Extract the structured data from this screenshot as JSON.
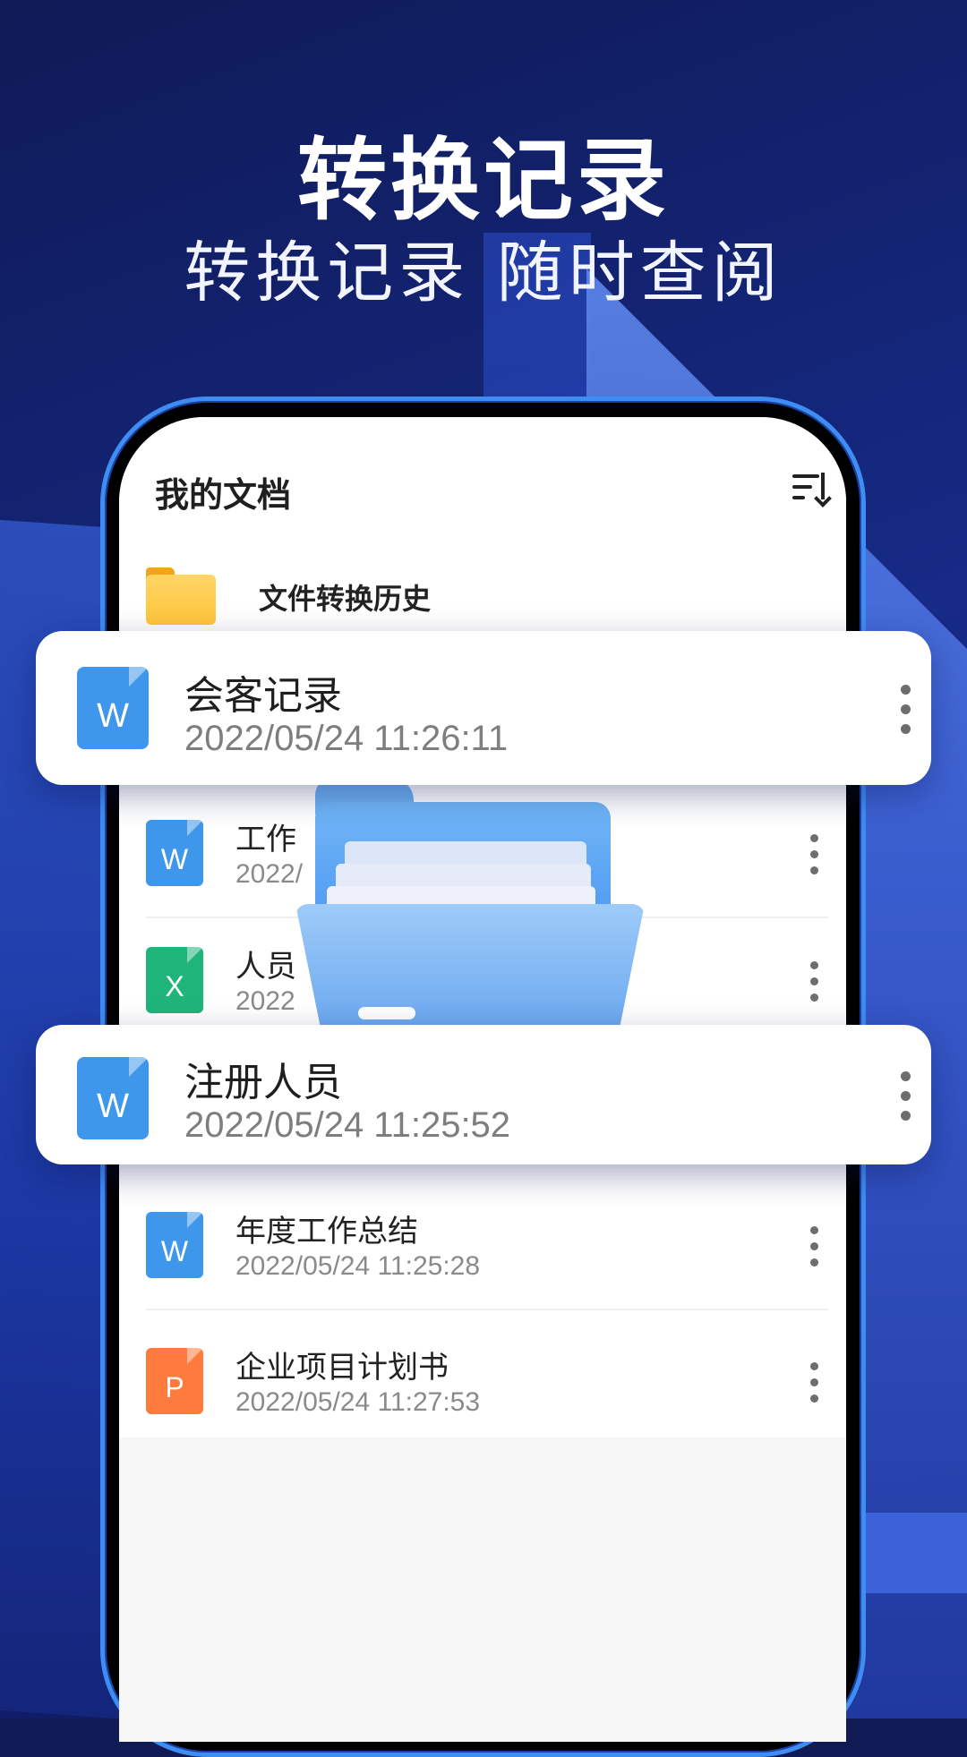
{
  "hero": {
    "title": "转换记录",
    "subtitle": "转换记录 随时查阅"
  },
  "screen": {
    "title": "我的文档",
    "folder": {
      "label": "文件转换历史"
    },
    "list": [
      {
        "name": "工作总结",
        "visible_name": "工作",
        "time": "2022/",
        "type": "W"
      },
      {
        "name": "人员",
        "visible_name": "人员",
        "time": "2022",
        "type": "X"
      },
      {
        "name": "年度工作总结",
        "time": "2022/05/24 11:25:28",
        "type": "W"
      },
      {
        "name": "企业项目计划书",
        "time": "2022/05/24 11:27:53",
        "type": "P"
      }
    ]
  },
  "cards": [
    {
      "name": "会客记录",
      "time": "2022/05/24 11:26:11",
      "type": "W"
    },
    {
      "name": "注册人员",
      "time": "2022/05/24 11:25:52",
      "type": "W"
    }
  ],
  "colors": {
    "word": "#3f97ec",
    "excel": "#1fb57a",
    "ppt": "#ff7a3d",
    "folder": "#ffc53a",
    "phone_border": "#3e8df2"
  }
}
